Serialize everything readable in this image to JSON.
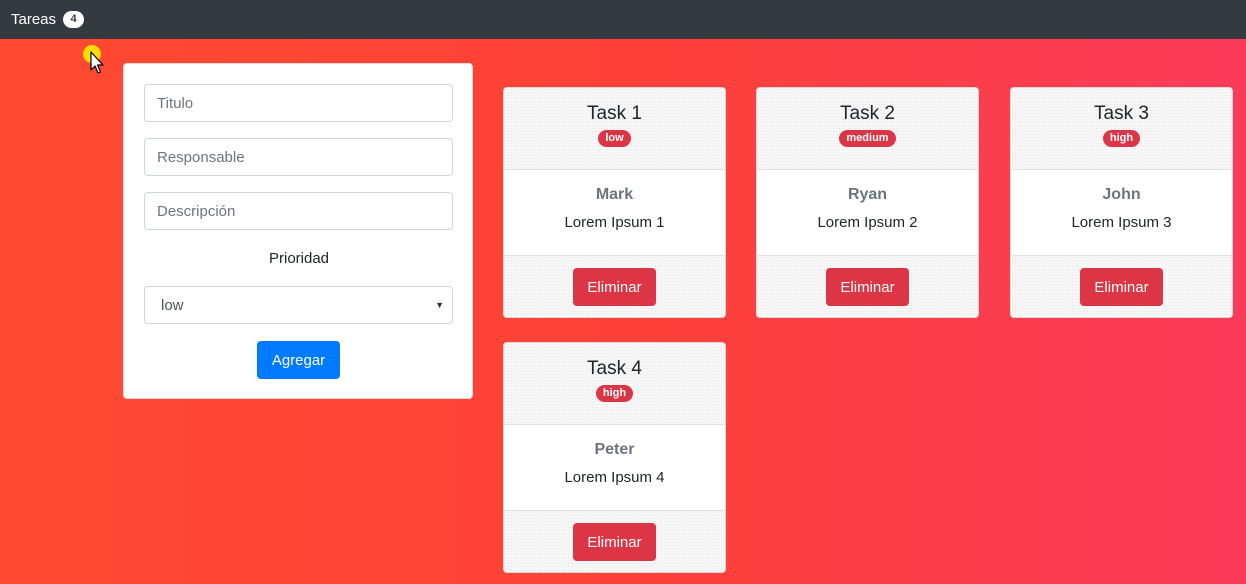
{
  "navbar": {
    "title": "Tareas",
    "count": "4"
  },
  "form": {
    "title_placeholder": "Titulo",
    "responsible_placeholder": "Responsable",
    "description_placeholder": "Descripción",
    "priority_label": "Prioridad",
    "priority_selected": "low",
    "submit_label": "Agregar"
  },
  "tasks": [
    {
      "title": "Task 1",
      "priority": "low",
      "responsible": "Mark",
      "description": "Lorem Ipsum 1",
      "delete_label": "Eliminar"
    },
    {
      "title": "Task 2",
      "priority": "medium",
      "responsible": "Ryan",
      "description": "Lorem Ipsum 2",
      "delete_label": "Eliminar"
    },
    {
      "title": "Task 3",
      "priority": "high",
      "responsible": "John",
      "description": "Lorem Ipsum 3",
      "delete_label": "Eliminar"
    },
    {
      "title": "Task 4",
      "priority": "high",
      "responsible": "Peter",
      "description": "Lorem Ipsum 4",
      "delete_label": "Eliminar"
    }
  ],
  "colors": {
    "navbar_bg": "#343a40",
    "primary": "#007bff",
    "danger": "#dc3545",
    "background_start": "#ff4a2f",
    "background_end": "#fb3b5a"
  }
}
